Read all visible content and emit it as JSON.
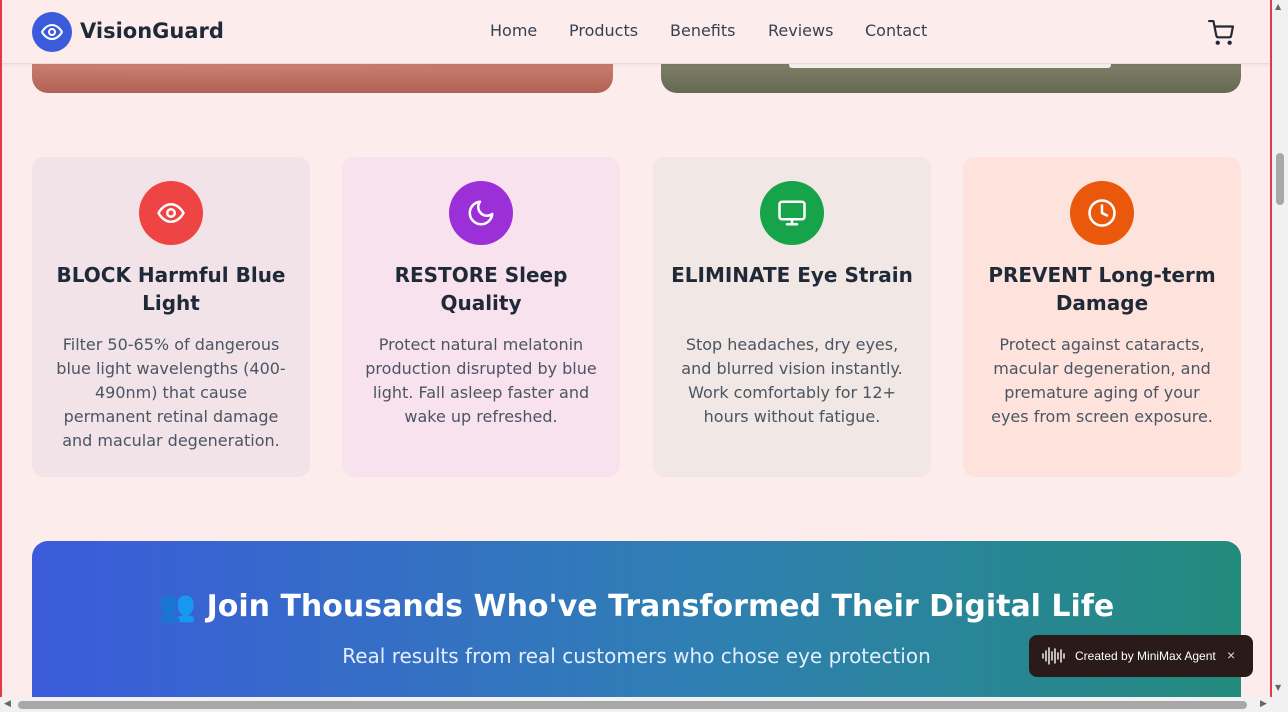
{
  "header": {
    "brand": "VisionGuard",
    "nav": [
      "Home",
      "Products",
      "Benefits",
      "Reviews",
      "Contact"
    ]
  },
  "benefits": [
    {
      "icon": "eye-icon",
      "color": "#ef4444",
      "bg": "#f1e3e8",
      "title": "BLOCK Harmful Blue Light",
      "text": "Filter 50-65% of dangerous blue light wavelengths (400-490nm) that cause permanent retinal damage and macular degeneration."
    },
    {
      "icon": "moon-icon",
      "color": "#9b30d9",
      "bg": "#f8e2ee",
      "title": "RESTORE Sleep Quality",
      "text": "Protect natural melatonin production disrupted by blue light. Fall asleep faster and wake up refreshed."
    },
    {
      "icon": "monitor-icon",
      "color": "#16a34a",
      "bg": "#f1e7e4",
      "title": "ELIMINATE Eye Strain",
      "text": "Stop headaches, dry eyes, and blurred vision instantly. Work comfortably for 12+ hours without fatigue."
    },
    {
      "icon": "clock-icon",
      "color": "#ea580c",
      "bg": "#fde3dc",
      "title": "PREVENT Long-term Damage",
      "text": "Protect against cataracts, macular degeneration, and premature aging of your eyes from screen exposure."
    }
  ],
  "banner": {
    "emoji": "👥",
    "title": "Join Thousands Who've Transformed Their Digital Life",
    "subtitle": "Real results from real customers who chose eye protection"
  },
  "toast": {
    "label": "Created by MiniMax Agent",
    "close": "×"
  }
}
